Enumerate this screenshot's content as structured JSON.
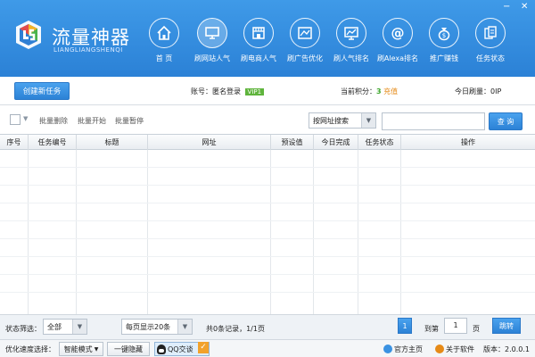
{
  "app": {
    "title": "流量神器",
    "subtitle": "LIANGLIANGSHENQI"
  },
  "window_controls": [
    "−",
    "✕"
  ],
  "nav": [
    {
      "label": "首 页",
      "icon": "home-icon"
    },
    {
      "label": "刷网站人气",
      "icon": "monitor-icon"
    },
    {
      "label": "刷电商人气",
      "icon": "shop-icon"
    },
    {
      "label": "刷广告优化",
      "icon": "ad-icon"
    },
    {
      "label": "刷人气排名",
      "icon": "chart-icon"
    },
    {
      "label": "刷Alexa排名",
      "icon": "at-icon"
    },
    {
      "label": "推广赚钱",
      "icon": "money-bag-icon"
    },
    {
      "label": "任务状态",
      "icon": "documents-icon"
    }
  ],
  "infobar": {
    "create_button": "创建新任务",
    "account_label": "账号：",
    "account_value": "匿名登录",
    "vip": "VIP1",
    "points_label": "当前积分：",
    "points_value": "3",
    "recharge": "充值",
    "today_label": "今日刷量：",
    "today_value": "0IP"
  },
  "toolbar": {
    "batch_delete": "批量删除",
    "batch_start": "批量开始",
    "batch_pause": "批量暂停",
    "search_mode": "按网址搜索",
    "search_value": "",
    "query_button": "查 询"
  },
  "table": {
    "columns": [
      "序号",
      "任务编号",
      "标题",
      "网址",
      "预设值",
      "今日完成",
      "任务状态",
      "操作"
    ],
    "rows": []
  },
  "statusbar": {
    "filter_label": "状态筛选：",
    "filter_value": "全部",
    "per_page": "每页显示20条",
    "record_info": "共0条记录，1/1页",
    "current_page": "1",
    "goto_label": "到第",
    "goto_value": "1",
    "page_unit": "页",
    "go_button": "跳转"
  },
  "footer": {
    "optimize_label": "优化速度选择：",
    "mode_value": "智能模式",
    "hide_button": "一键隐藏",
    "qq_button": "QQ交谈",
    "home_link": "官方主页",
    "about_link": "关于软件",
    "version": "版本：2.0.0.1"
  },
  "colors": {
    "header": "#3a92e2",
    "accent_green": "#3ea72c",
    "accent_orange": "#e68a17"
  }
}
